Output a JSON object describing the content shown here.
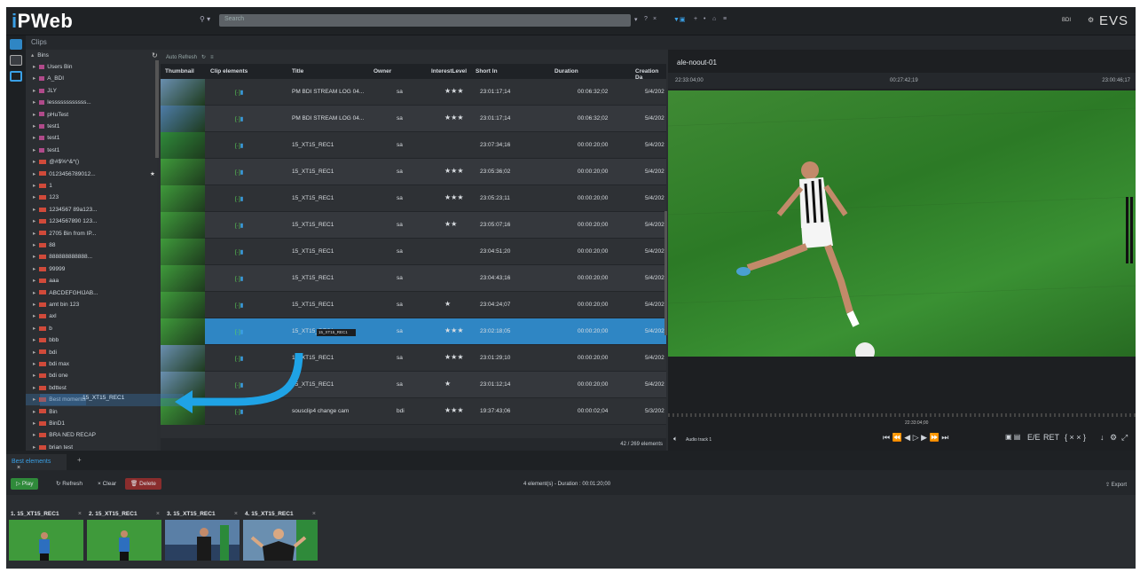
{
  "app": {
    "logo": "iPWeb",
    "brand": "EVS",
    "search_placeholder": "Search",
    "user": "BDI"
  },
  "toolbar": {
    "icons": [
      "chevron-down-icon",
      "question-icon",
      "close-icon",
      "filter-icon",
      "plus-icon",
      "home-icon",
      "menu-icon"
    ]
  },
  "bins_header": "Clips",
  "tree": {
    "root": "Bins",
    "items": [
      {
        "label": "Users Bin",
        "type": "user"
      },
      {
        "label": "A_BDI",
        "type": "user"
      },
      {
        "label": "JLY",
        "type": "user"
      },
      {
        "label": "lessssssssssss...",
        "type": "user"
      },
      {
        "label": "pHuTest",
        "type": "user"
      },
      {
        "label": "test1",
        "type": "user"
      },
      {
        "label": "test1",
        "type": "user"
      },
      {
        "label": "test1",
        "type": "user"
      },
      {
        "label": "@#$%^&*()",
        "type": "folder"
      },
      {
        "label": "0123456789012...",
        "type": "folder"
      },
      {
        "label": "1",
        "type": "folder"
      },
      {
        "label": "123",
        "type": "folder"
      },
      {
        "label": "1234567 89a123...",
        "type": "folder"
      },
      {
        "label": "1234567890 123...",
        "type": "folder"
      },
      {
        "label": "2705 Bin from IP...",
        "type": "folder"
      },
      {
        "label": "88",
        "type": "folder"
      },
      {
        "label": "888888888888...",
        "type": "folder"
      },
      {
        "label": "99999",
        "type": "folder"
      },
      {
        "label": "aaa",
        "type": "folder"
      },
      {
        "label": "ABCDEFGHIJAB...",
        "type": "folder"
      },
      {
        "label": "amt bin 123",
        "type": "folder"
      },
      {
        "label": "axl",
        "type": "folder"
      },
      {
        "label": "b",
        "type": "folder"
      },
      {
        "label": "bbb",
        "type": "folder"
      },
      {
        "label": "bdi",
        "type": "folder"
      },
      {
        "label": "bdi max",
        "type": "folder"
      },
      {
        "label": "bdi one",
        "type": "folder"
      },
      {
        "label": "bdttest",
        "type": "folder"
      },
      {
        "label": "Best moments",
        "type": "folder"
      },
      {
        "label": "Bin",
        "type": "folder"
      },
      {
        "label": "BinD1",
        "type": "folder"
      },
      {
        "label": "BRA NED RECAP",
        "type": "folder"
      },
      {
        "label": "brian test",
        "type": "folder"
      }
    ]
  },
  "grid": {
    "auto_refresh": "Auto Refresh",
    "columns": [
      "Thumbnail",
      "Clip elements",
      "Title",
      "Owner",
      "InterestLevel",
      "Short In",
      "Duration",
      "Creation Da"
    ],
    "rows": [
      {
        "title": "PM BDI STREAM LOG 04...",
        "owner": "sa",
        "stars": "★★★",
        "short_in": "23:01:17;14",
        "duration": "00:06:32;02",
        "date": "5/4/202"
      },
      {
        "title": "PM BDI STREAM LOG 04...",
        "owner": "sa",
        "stars": "★★★",
        "short_in": "23:01:17;14",
        "duration": "00:06:32;02",
        "date": "5/4/202"
      },
      {
        "title": "15_XT15_REC1",
        "owner": "sa",
        "stars": "",
        "short_in": "23:07:34;16",
        "duration": "00:00:20;00",
        "date": "5/4/202"
      },
      {
        "title": "15_XT15_REC1",
        "owner": "sa",
        "stars": "★★★",
        "short_in": "23:05:36;02",
        "duration": "00:00:20;00",
        "date": "5/4/202"
      },
      {
        "title": "15_XT15_REC1",
        "owner": "sa",
        "stars": "★★★",
        "short_in": "23:05:23;11",
        "duration": "00:00:20;00",
        "date": "5/4/202"
      },
      {
        "title": "15_XT15_REC1",
        "owner": "sa",
        "stars": "★★",
        "short_in": "23:05:07;16",
        "duration": "00:00:20;00",
        "date": "5/4/202"
      },
      {
        "title": "15_XT15_REC1",
        "owner": "sa",
        "stars": "",
        "short_in": "23:04:51;20",
        "duration": "00:00:20;00",
        "date": "5/4/202"
      },
      {
        "title": "15_XT15_REC1",
        "owner": "sa",
        "stars": "",
        "short_in": "23:04:43;16",
        "duration": "00:00:20;00",
        "date": "5/4/202"
      },
      {
        "title": "15_XT15_REC1",
        "owner": "sa",
        "stars": "★",
        "short_in": "23:04:24;07",
        "duration": "00:00:20;00",
        "date": "5/4/202"
      },
      {
        "title": "15_XT15_REC1",
        "owner": "sa",
        "stars": "★★★",
        "short_in": "23:02:18;05",
        "duration": "00:00:20;00",
        "date": "5/4/202"
      },
      {
        "title": "15_XT15_REC1",
        "owner": "sa",
        "stars": "★★★",
        "short_in": "23:01:29;10",
        "duration": "00:00:20;00",
        "date": "5/4/202"
      },
      {
        "title": "15_XT15_REC1",
        "owner": "sa",
        "stars": "★",
        "short_in": "23:01:12;14",
        "duration": "00:00:20;00",
        "date": "5/4/202"
      },
      {
        "title": "sousclip4 change cam",
        "owner": "bdi",
        "stars": "★★★",
        "short_in": "19:37:43;06",
        "duration": "00:00:02;04",
        "date": "5/3/202"
      }
    ],
    "tooltip": "15_XT15_REC1",
    "count": "42 / 269 elements"
  },
  "drag_label": "15_XT15_REC1",
  "player": {
    "title": "ale-noout-01",
    "time_left": "22:33:04;00",
    "time_mid": "00:27:42;19",
    "time_right": "23:00:46;17",
    "audio": "Audio track 1",
    "timecode": "22:33:04;00",
    "ee": "E/E",
    "ret": "RET"
  },
  "bottom": {
    "tab": "Best elements",
    "play": "Play",
    "refresh": "Refresh",
    "clear": "Clear",
    "delete": "Delete",
    "info": "4 element(s) - Duration : 00:01:20;00",
    "export": "Export"
  },
  "elements": [
    {
      "label": "1. 15_XT15_REC1"
    },
    {
      "label": "2. 15_XT15_REC1"
    },
    {
      "label": "3. 15_XT15_REC1"
    },
    {
      "label": "4. 15_XT15_REC1"
    }
  ],
  "colors": {
    "accent": "#3aa0e6",
    "selected_row": "#2f86c4",
    "play": "#2f8a3a",
    "delete": "#8a2d2d",
    "folder": "#d04a3a"
  }
}
